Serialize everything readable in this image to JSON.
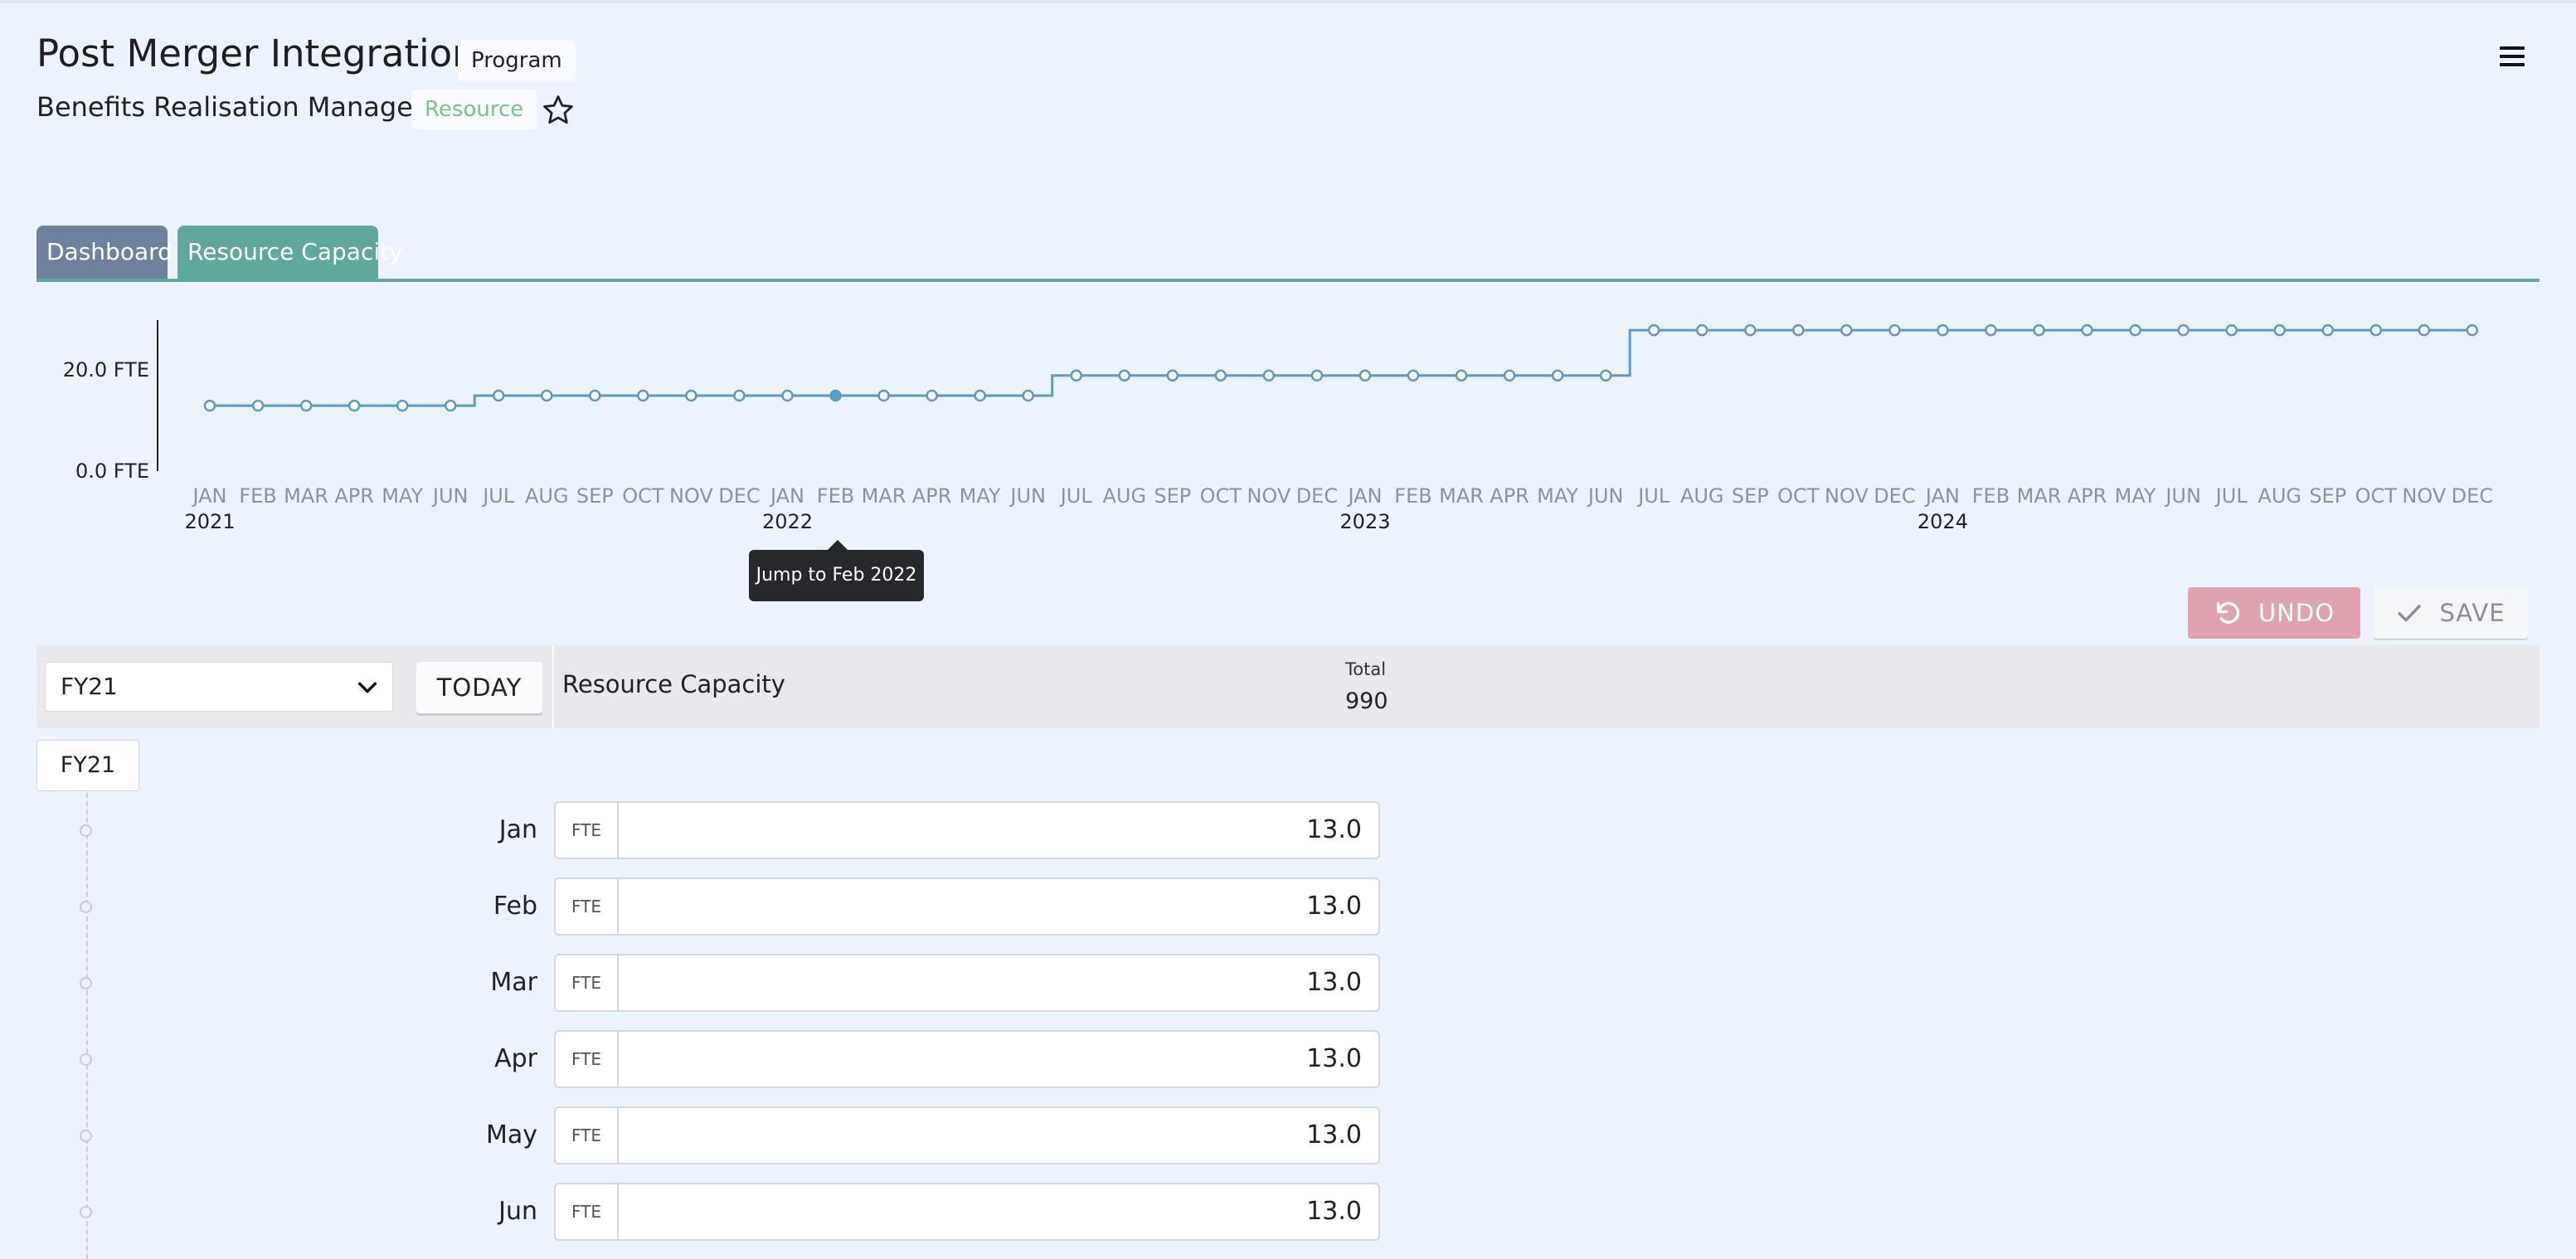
{
  "header": {
    "title": "Post Merger Integration",
    "program_badge": "Program",
    "subtitle": "Benefits Realisation Manager",
    "resource_badge": "Resource"
  },
  "tabs": [
    {
      "label": "Dashboard",
      "active": false
    },
    {
      "label": "Resource Capacity",
      "active": true
    }
  ],
  "chart_data": {
    "type": "line",
    "step": true,
    "y_ticks": [
      "0.0 FTE",
      "20.0 FTE"
    ],
    "ylim": [
      0,
      30
    ],
    "months": [
      "JAN",
      "FEB",
      "MAR",
      "APR",
      "MAY",
      "JUN",
      "JUL",
      "AUG",
      "SEP",
      "OCT",
      "NOV",
      "DEC"
    ],
    "years": [
      "2021",
      "2022",
      "2023",
      "2024"
    ],
    "values": [
      13,
      13,
      13,
      13,
      13,
      13,
      15,
      15,
      15,
      15,
      15,
      15,
      15,
      15,
      15,
      15,
      15,
      15,
      19,
      19,
      19,
      19,
      19,
      19,
      19,
      19,
      19,
      19,
      19,
      19,
      28,
      28,
      28,
      28,
      28,
      28,
      28,
      28,
      28,
      28,
      28,
      28,
      28,
      28,
      28,
      28,
      28,
      28
    ],
    "highlighted_index": 13,
    "line_color": "#5b99c6"
  },
  "tooltip": "Jump to Feb 2022",
  "toolbar": {
    "undo_label": "UNDO",
    "save_label": "SAVE"
  },
  "panel": {
    "fy_select_value": "FY21",
    "today_label": "TODAY",
    "title": "Resource Capacity",
    "total_label": "Total",
    "total_value": "990",
    "fy_chip": "FY21",
    "unit": "FTE",
    "rows": [
      {
        "month": "Jan",
        "value": "13.0"
      },
      {
        "month": "Feb",
        "value": "13.0"
      },
      {
        "month": "Mar",
        "value": "13.0"
      },
      {
        "month": "Apr",
        "value": "13.0"
      },
      {
        "month": "May",
        "value": "13.0"
      },
      {
        "month": "Jun",
        "value": "13.0"
      }
    ]
  },
  "icons": {
    "star": "star-outline-icon",
    "menu": "hamburger-menu-icon",
    "undo": "undo-arrow-icon",
    "save": "checkmark-icon",
    "select": "chevron-down-icon"
  }
}
